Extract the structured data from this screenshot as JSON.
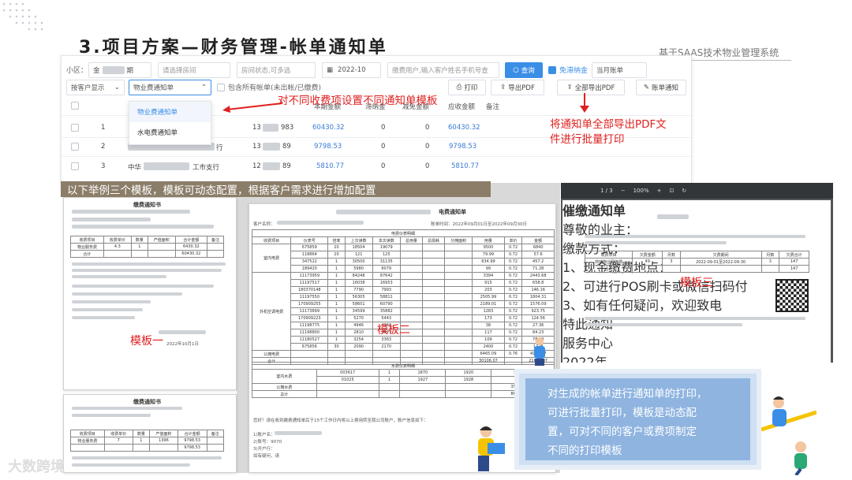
{
  "slide": {
    "title": "3.项目方案—财务管理-帐单通知单",
    "brand": "基于SAAS技术物业管理系统",
    "watermark": "大数跨境"
  },
  "toolbar": {
    "area_label": "小区：",
    "area_value": "金",
    "area_value_suffix": "期",
    "room_placeholder": "请选择房间",
    "status_placeholder": "房间状态,可多选",
    "month_value": "2022-10",
    "search_placeholder": "缴费用户,输入客户姓名手机号查",
    "query_label": "查询",
    "free_label": "免滞纳金",
    "period_value": "当月账单",
    "display_value": "按客户显示",
    "template_value": "物业费通知单",
    "include_label": "包含所有帐单(未出帐/已缴费)",
    "print_label": "打印",
    "export_label": "导出PDF",
    "export_all_label": "全部导出PDF",
    "notice_label": "账单通知"
  },
  "table": {
    "headers": [
      "本期金额",
      "滞纳金",
      "减免金额",
      "应收金额",
      "备注"
    ],
    "rows": [
      {
        "index": "1",
        "name": "",
        "phone": "13",
        "phone_tail": "983",
        "amount": "60430.32",
        "late": "0",
        "reduce": "0",
        "due": "60430.32"
      },
      {
        "index": "2",
        "name": "",
        "name_tail": "行",
        "phone": "13",
        "phone_tail": "89",
        "amount": "9798.53",
        "late": "0",
        "reduce": "0",
        "due": "9798.53"
      },
      {
        "index": "3",
        "name": "中华",
        "name_tail": "工市支行",
        "phone": "12",
        "phone_tail": "89",
        "amount": "5810.77",
        "late": "0",
        "reduce": "0",
        "due": "5810.77"
      }
    ]
  },
  "dropdown": {
    "options": [
      "物业费通知单",
      "水电费通知单"
    ]
  },
  "annotations": {
    "template_note": "对不同收费项设置不同通知单模板",
    "export_note_line1": "将通知单全部导出PDF文",
    "export_note_line2": "件进行批量打印",
    "banner": "以下举例三个模板，模板可动态配置，根据客户需求进行增加配置",
    "template1": "模板一",
    "template2": "模板二",
    "template3": "模板三"
  },
  "doc1": {
    "title": "缴费通知书",
    "code": "缴费单号：",
    "date": "2022年10月1日",
    "headers": [
      "收费项目",
      "收费单价",
      "数量",
      "产值面积",
      "合计金额",
      "备注"
    ],
    "row": [
      "物业服务费",
      "4.3",
      "1",
      "",
      "6430.32",
      ""
    ],
    "total_label": "合计",
    "total": "60430.32"
  },
  "doc1b": {
    "title": "缴费通知书",
    "headers": [
      "收费项目",
      "收费单价",
      "数量",
      "产值面积",
      "合计金额",
      "备注"
    ],
    "row": [
      "物业服务费",
      "7",
      "1",
      "1396",
      "9798.53",
      ""
    ],
    "total": "9798.53"
  },
  "doc2": {
    "title": "电费通知单",
    "customer_label": "客户名称：",
    "account_label": "账单时间：2022年09月01日至2022年09月30日",
    "header_group": "电费仪表明细",
    "headers": [
      "收费项目",
      "仪表号",
      "倍率",
      "上次读数",
      "本次读数",
      "总用量",
      "总损耗",
      "分摊面积",
      "用量",
      "单价",
      "金额"
    ],
    "group1": "室内电费",
    "group2": "外机空调电费",
    "group3": "公摊电费",
    "total_label": "合计",
    "water_header": "水费仪表明细",
    "water_group": "室内水费",
    "water_public": "公摊水费",
    "grand_total": "总计",
    "footer": "您好！请在收到缴费通知单后于15个工作日内将以上费用转至我公司账户，账户信息如下：",
    "acct1": "1)账户名：",
    "acct2": "2)账号：9070",
    "acct3": "3)开户行：",
    "acct4": "如有疑问，请",
    "rows": [
      [
        "675859",
        "20",
        "18504",
        "19079",
        "9500",
        "0.72",
        "6840"
      ],
      [
        "118864",
        "20",
        "121",
        "125",
        "79.99",
        "0.72",
        "57.6"
      ],
      [
        "347522",
        "1",
        "30500",
        "31135",
        "634.99",
        "0.72",
        "457.2"
      ],
      [
        "189420",
        "1",
        "5980",
        "6079",
        "99",
        "0.72",
        "71.28"
      ],
      [
        "11173959",
        "1",
        "84248",
        "87642",
        "3394",
        "0.72",
        "2443.68"
      ],
      [
        "11197517",
        "1",
        "16038",
        "16953",
        "915",
        "0.72",
        "658.8"
      ],
      [
        "180370148",
        "1",
        "7790",
        "7993",
        "203",
        "0.72",
        "146.16"
      ],
      [
        "11197550",
        "1",
        "56305",
        "58811",
        "2505.99",
        "0.72",
        "1804.31"
      ],
      [
        "170909255",
        "1",
        "58601",
        "60790",
        "2189.01",
        "0.72",
        "1576.09"
      ],
      [
        "11173899",
        "1",
        "34599",
        "35882",
        "1283",
        "0.72",
        "923.75"
      ],
      [
        "170909223",
        "1",
        "5270",
        "5443",
        "173",
        "0.72",
        "124.56"
      ],
      [
        "11198775",
        "1",
        "4946",
        "4984",
        "38",
        "0.72",
        "27.36"
      ],
      [
        "11198800",
        "1",
        "2810",
        "2927",
        "117",
        "0.72",
        "84.23"
      ],
      [
        "11180527",
        "1",
        "3254",
        "3363",
        "109",
        "0.72",
        "78.48"
      ],
      [
        "675856",
        "30",
        "2090",
        "2170",
        "2400",
        "0.72",
        "1728"
      ]
    ],
    "public_row": [
      "6465.09",
      "0.76",
      "4913.47"
    ],
    "total_row": [
      "30106.07",
      "21658.07"
    ],
    "water_rows": [
      [
        "003617",
        "1",
        "1870",
        "1920",
        "50"
      ],
      [
        "01025",
        "1",
        "1927",
        "1928",
        "1"
      ]
    ],
    "water_public_row": [
      "35.04"
    ],
    "water_total_row": [
      "86.04"
    ]
  },
  "viewer": {
    "page_indicator": "1 / 3",
    "zoom": "100%",
    "doc_title": "催缴通知单",
    "greeting": "尊敬的业主：",
    "headers": [
      "收费项目",
      "欠费金额",
      "月数",
      "欠费期间",
      "月数",
      "欠费合计"
    ],
    "row": [
      "商铺物业服务费",
      "49",
      "3",
      "2022-09-01至2022-09-30",
      "3",
      "147"
    ],
    "total_label": "合计",
    "total": "147",
    "notice_label": "缴款方式：",
    "item1": "1、现金缴费地点：",
    "item2": "2、可进行POS刷卡或微信扫码付",
    "item3": "3、如有任何疑问，欢迎致电",
    "closing": "特此通知",
    "signature": "服务中心",
    "date": "2022年"
  },
  "callout": {
    "line1": "对生成的帐单进行通知单的打印，",
    "line2": "可进行批量打印，模板是动态配",
    "line3": "置，可对不同的客户或费项制定",
    "line4": "不同的打印模板"
  },
  "colors": {
    "accent": "#3a8ee6",
    "note_red": "#e02020",
    "banner": "#8b7d68",
    "callout": "#8fb4e0"
  }
}
